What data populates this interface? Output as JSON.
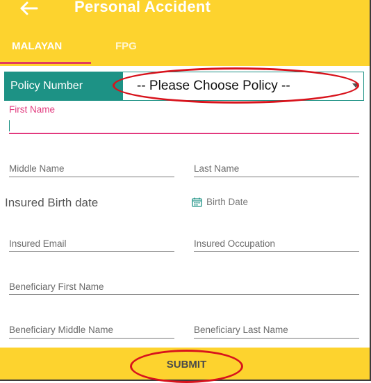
{
  "header": {
    "title": "Personal Accident",
    "back_icon": "arrow-left-icon"
  },
  "tabs": [
    {
      "label": "MALAYAN",
      "active": true
    },
    {
      "label": "FPG",
      "active": false
    }
  ],
  "policy": {
    "label": "Policy Number",
    "selected": "-- Please Choose Policy --"
  },
  "fields": {
    "first_name": {
      "label": "First Name",
      "value": ""
    },
    "middle_name": {
      "label": "Middle Name",
      "value": ""
    },
    "last_name": {
      "label": "Last Name",
      "value": ""
    },
    "insured_birth_title": "Insured Birth date",
    "birth_date": {
      "label": "Birth Date",
      "icon": "calendar-icon"
    },
    "insured_email": {
      "label": "Insured Email",
      "value": ""
    },
    "insured_occupation": {
      "label": "Insured Occupation",
      "value": ""
    },
    "beneficiary_first_name": {
      "label": "Beneficiary First Name",
      "value": ""
    },
    "beneficiary_middle_name": {
      "label": "Beneficiary Middle Name",
      "value": ""
    },
    "beneficiary_last_name": {
      "label": "Beneficiary Last Name",
      "value": ""
    }
  },
  "submit": {
    "label": "SUBMIT"
  },
  "colors": {
    "brand_yellow": "#fdd32e",
    "teal": "#1d9285",
    "accent_pink": "#e23a7e",
    "annotation_red": "#d8131c"
  }
}
